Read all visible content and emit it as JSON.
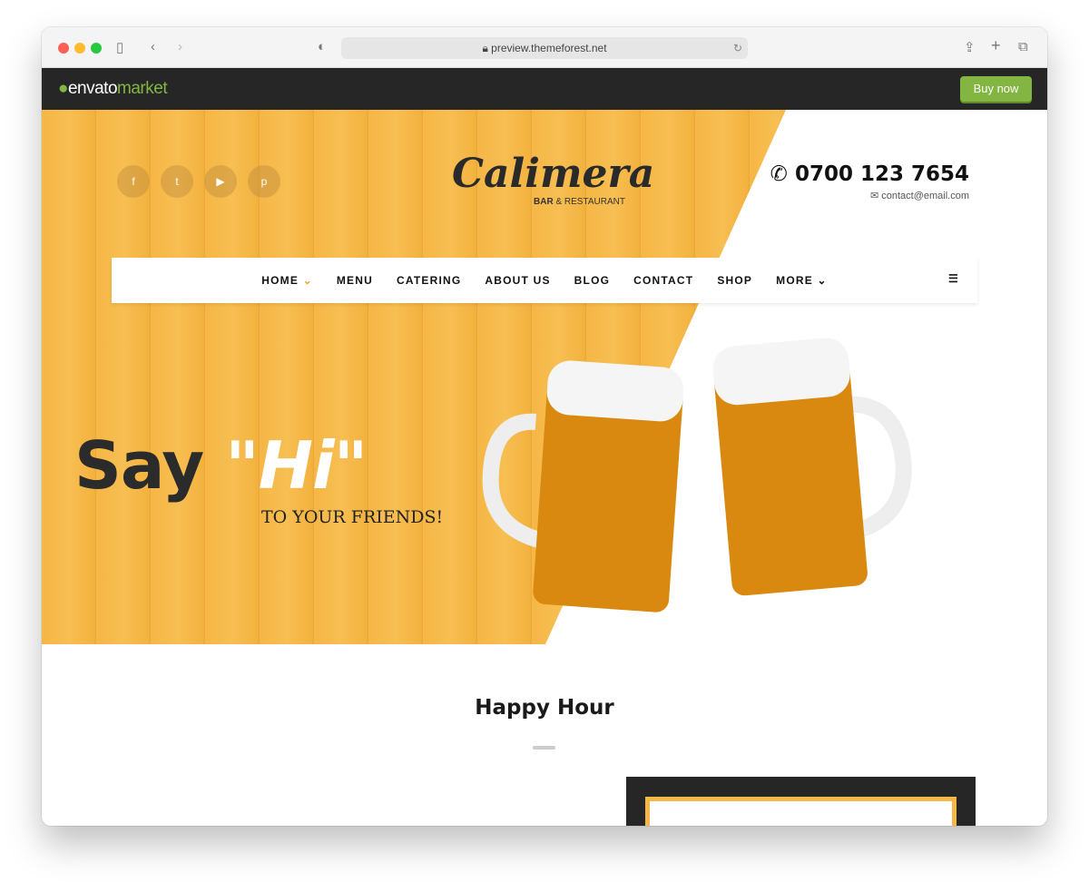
{
  "browser": {
    "url": "preview.themeforest.net"
  },
  "envato": {
    "logo_a": "envato",
    "logo_b": "market",
    "buy_label": "Buy now",
    "accent": "#82b541"
  },
  "header": {
    "social": [
      "facebook-icon",
      "twitter-icon",
      "youtube-icon",
      "pinterest-icon"
    ],
    "brand": "Calimera",
    "brand_sub_a": "BAR",
    "brand_sub_b": "& RESTAURANT",
    "phone": "0700 123 7654",
    "email": "contact@email.com"
  },
  "nav": {
    "items": [
      "HOME",
      "MENU",
      "CATERING",
      "ABOUT US",
      "BLOG",
      "CONTACT",
      "SHOP",
      "MORE"
    ],
    "active": "HOME",
    "active_color": "#f0a92e"
  },
  "hero": {
    "say": "Say",
    "hi": "\"Hi\"",
    "sub": "TO YOUR FRIENDS!"
  },
  "section": {
    "title": "Happy Hour"
  }
}
